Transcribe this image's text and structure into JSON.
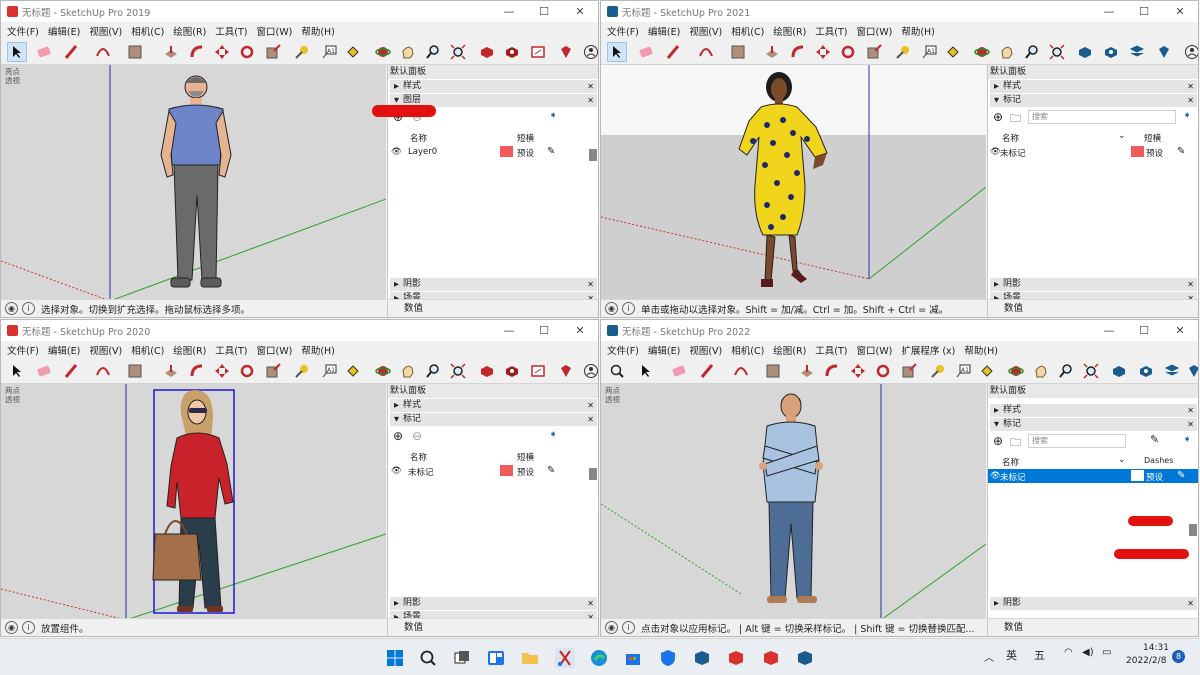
{
  "windows": {
    "w1": {
      "title": "无标题 - SketchUp Pro 2019",
      "menus": [
        "文件(F)",
        "编辑(E)",
        "视图(V)",
        "相机(C)",
        "绘图(R)",
        "工具(T)",
        "窗口(W)",
        "帮助(H)"
      ],
      "viewport_label": "亮点\n透视",
      "tray": {
        "title": "默认面板",
        "sections_top": [
          {
            "label": "样式",
            "open": false
          },
          {
            "label": "图层",
            "open": true
          }
        ],
        "col_name": "名称",
        "col_dash": "短横",
        "rows": [
          {
            "name": "Layer0",
            "dash": "预设"
          }
        ],
        "sections_bottom": [
          {
            "label": "阴影"
          },
          {
            "label": "场景"
          }
        ]
      },
      "status": "选择对象。切换到扩充选择。拖动鼠标选择多项。",
      "measure": "数值"
    },
    "w2": {
      "title": "无标题 - SketchUp Pro 2021",
      "menus": [
        "文件(F)",
        "编辑(E)",
        "视图(V)",
        "相机(C)",
        "绘图(R)",
        "工具(T)",
        "窗口(W)",
        "帮助(H)"
      ],
      "viewport_label": "",
      "tray": {
        "title": "默认面板",
        "sections_top": [
          {
            "label": "样式",
            "open": false
          },
          {
            "label": "标记",
            "open": true
          }
        ],
        "search_placeholder": "搜索",
        "col_name": "名称",
        "col_dash": "短横",
        "rows": [
          {
            "name": "未标记",
            "dash": "预设"
          }
        ],
        "sections_bottom": [
          {
            "label": "阴影"
          },
          {
            "label": "场景"
          }
        ]
      },
      "status": "单击或拖动以选择对象。Shift = 加/减。Ctrl = 加。Shift + Ctrl = 减。",
      "measure": "数值"
    },
    "w3": {
      "title": "无标题 - SketchUp Pro 2020",
      "menus": [
        "文件(F)",
        "编辑(E)",
        "视图(V)",
        "相机(C)",
        "绘图(R)",
        "工具(T)",
        "窗口(W)",
        "帮助(H)"
      ],
      "viewport_label": "两点\n透视",
      "tray": {
        "title": "默认面板",
        "sections_top": [
          {
            "label": "样式",
            "open": false
          },
          {
            "label": "标记",
            "open": true
          }
        ],
        "col_name": "名称",
        "col_dash": "短横",
        "rows": [
          {
            "name": "未标记",
            "dash": "预设"
          }
        ],
        "sections_bottom": [
          {
            "label": "阴影"
          },
          {
            "label": "场景"
          }
        ]
      },
      "status": "放置组件。",
      "measure": "数值"
    },
    "w4": {
      "title": "无标题 - SketchUp Pro 2022",
      "menus": [
        "文件(F)",
        "编辑(E)",
        "视图(V)",
        "相机(C)",
        "绘图(R)",
        "工具(T)",
        "窗口(W)",
        "扩展程序 (x)",
        "帮助(H)"
      ],
      "viewport_label": "两点\n透视",
      "tray": {
        "title": "默认面板",
        "sections_top": [
          {
            "label": "样式",
            "open": false
          },
          {
            "label": "标记",
            "open": true
          }
        ],
        "search_placeholder": "搜索",
        "col_name": "名称",
        "col_dash": "Dashes",
        "rows": [
          {
            "name": "未标记",
            "dash": "预设"
          }
        ],
        "sections_bottom": [
          {
            "label": "阴影"
          }
        ]
      },
      "status": "点击对象以应用标记。 | Alt 键 = 切换采样标记。 | Shift 键 = 切换替换匹配...",
      "measure": "数值"
    }
  },
  "taskbar": {
    "ime_lang": "英",
    "ime_mode": "五",
    "time": "14:31",
    "date": "2022/2/8",
    "notification_count": "8"
  },
  "colors": {
    "accent": "#0078d7",
    "tag_color": "#ef5b5b",
    "annotation": "#e31010"
  }
}
